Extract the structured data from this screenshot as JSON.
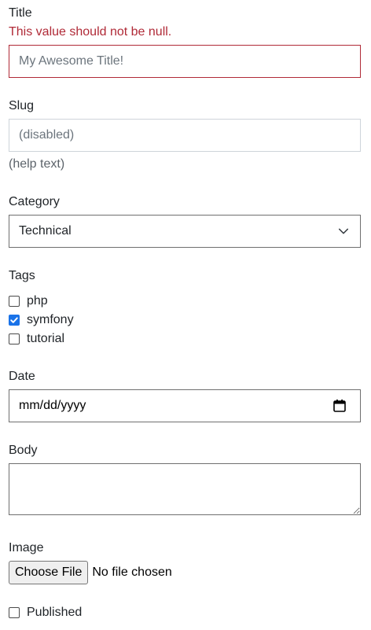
{
  "title": {
    "label": "Title",
    "error": "This value should not be null.",
    "placeholder": "My Awesome Title!"
  },
  "slug": {
    "label": "Slug",
    "placeholder": "(disabled)",
    "help": "(help text)"
  },
  "category": {
    "label": "Category",
    "selected": "Technical",
    "chevron_icon": "chevron-down-icon"
  },
  "tags": {
    "label": "Tags",
    "options": [
      {
        "label": "php",
        "checked": false
      },
      {
        "label": "symfony",
        "checked": true
      },
      {
        "label": "tutorial",
        "checked": false
      }
    ]
  },
  "date": {
    "label": "Date",
    "placeholder": "mm/dd/yyyy",
    "calendar_icon": "calendar-icon"
  },
  "body": {
    "label": "Body"
  },
  "image": {
    "label": "Image",
    "button": "Choose File",
    "status": "No file chosen"
  },
  "published": {
    "label": "Published",
    "checked": false
  },
  "colors": {
    "error": "#b02a37",
    "checkbox_checked": "#1a73e8"
  }
}
